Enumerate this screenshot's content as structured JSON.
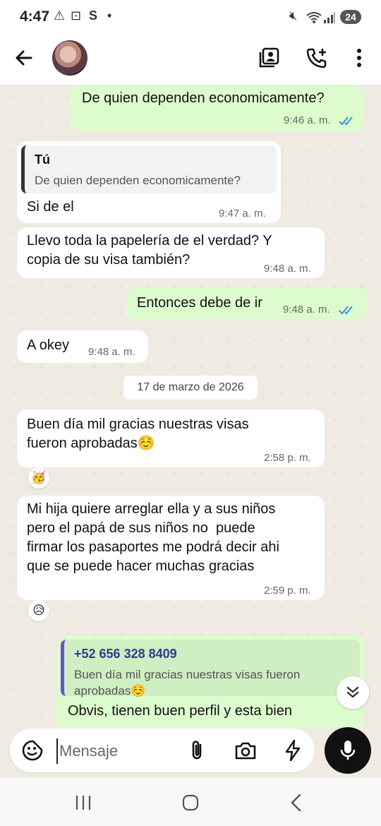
{
  "status_bar": {
    "time": "4:47",
    "battery": "24"
  },
  "header": {
    "back_icon": "arrow-left-icon",
    "actions": [
      "contact-card-icon",
      "add-call-icon",
      "more-vertical-icon"
    ]
  },
  "messages": [
    {
      "text": "De quien dependen economicamente?",
      "time": "9:46 a. m.",
      "direction": "out",
      "read": true
    },
    {
      "reply_name": "Tú",
      "reply_text": "De quien dependen economicamente?",
      "text": "Si de el",
      "time": "9:47 a. m.",
      "direction": "in"
    },
    {
      "text": "Llevo toda la papelería de el verdad? Y\ncopia de su visa también?",
      "time": "9:48 a. m.",
      "direction": "in"
    },
    {
      "text": "Entonces debe de ir",
      "time": "9:48 a. m.",
      "direction": "out",
      "read": true
    },
    {
      "text": "A okey",
      "time": "9:48 a. m.",
      "direction": "in"
    },
    {
      "text": "Buen día mil gracias nuestras visas\nfueron aprobadas☺️",
      "time": "2:58 p. m.",
      "direction": "in",
      "reaction": "🥳"
    },
    {
      "text": "Mi hija quiere arreglar ella y a sus niños\npero el papá de sus niños no  puede\nfirmar los pasaportes me podrá decir ahi\nque se puede hacer muchas gracias",
      "time": "2:59 p. m.",
      "direction": "in",
      "reaction": "😥"
    },
    {
      "reply_name": "+52 656 328 8409",
      "reply_text": "Buen día mil gracias nuestras visas fueron\naprobadas☺️",
      "text": "Obvis, tienen buen perfil y esta bien",
      "direction": "out"
    }
  ],
  "date_divider": "17 de marzo de 2026",
  "composer": {
    "placeholder": "Mensaje"
  },
  "colors": {
    "outgoing": "#dcfcce",
    "incoming": "#ffffff",
    "read_tick": "#3b8fd9"
  }
}
